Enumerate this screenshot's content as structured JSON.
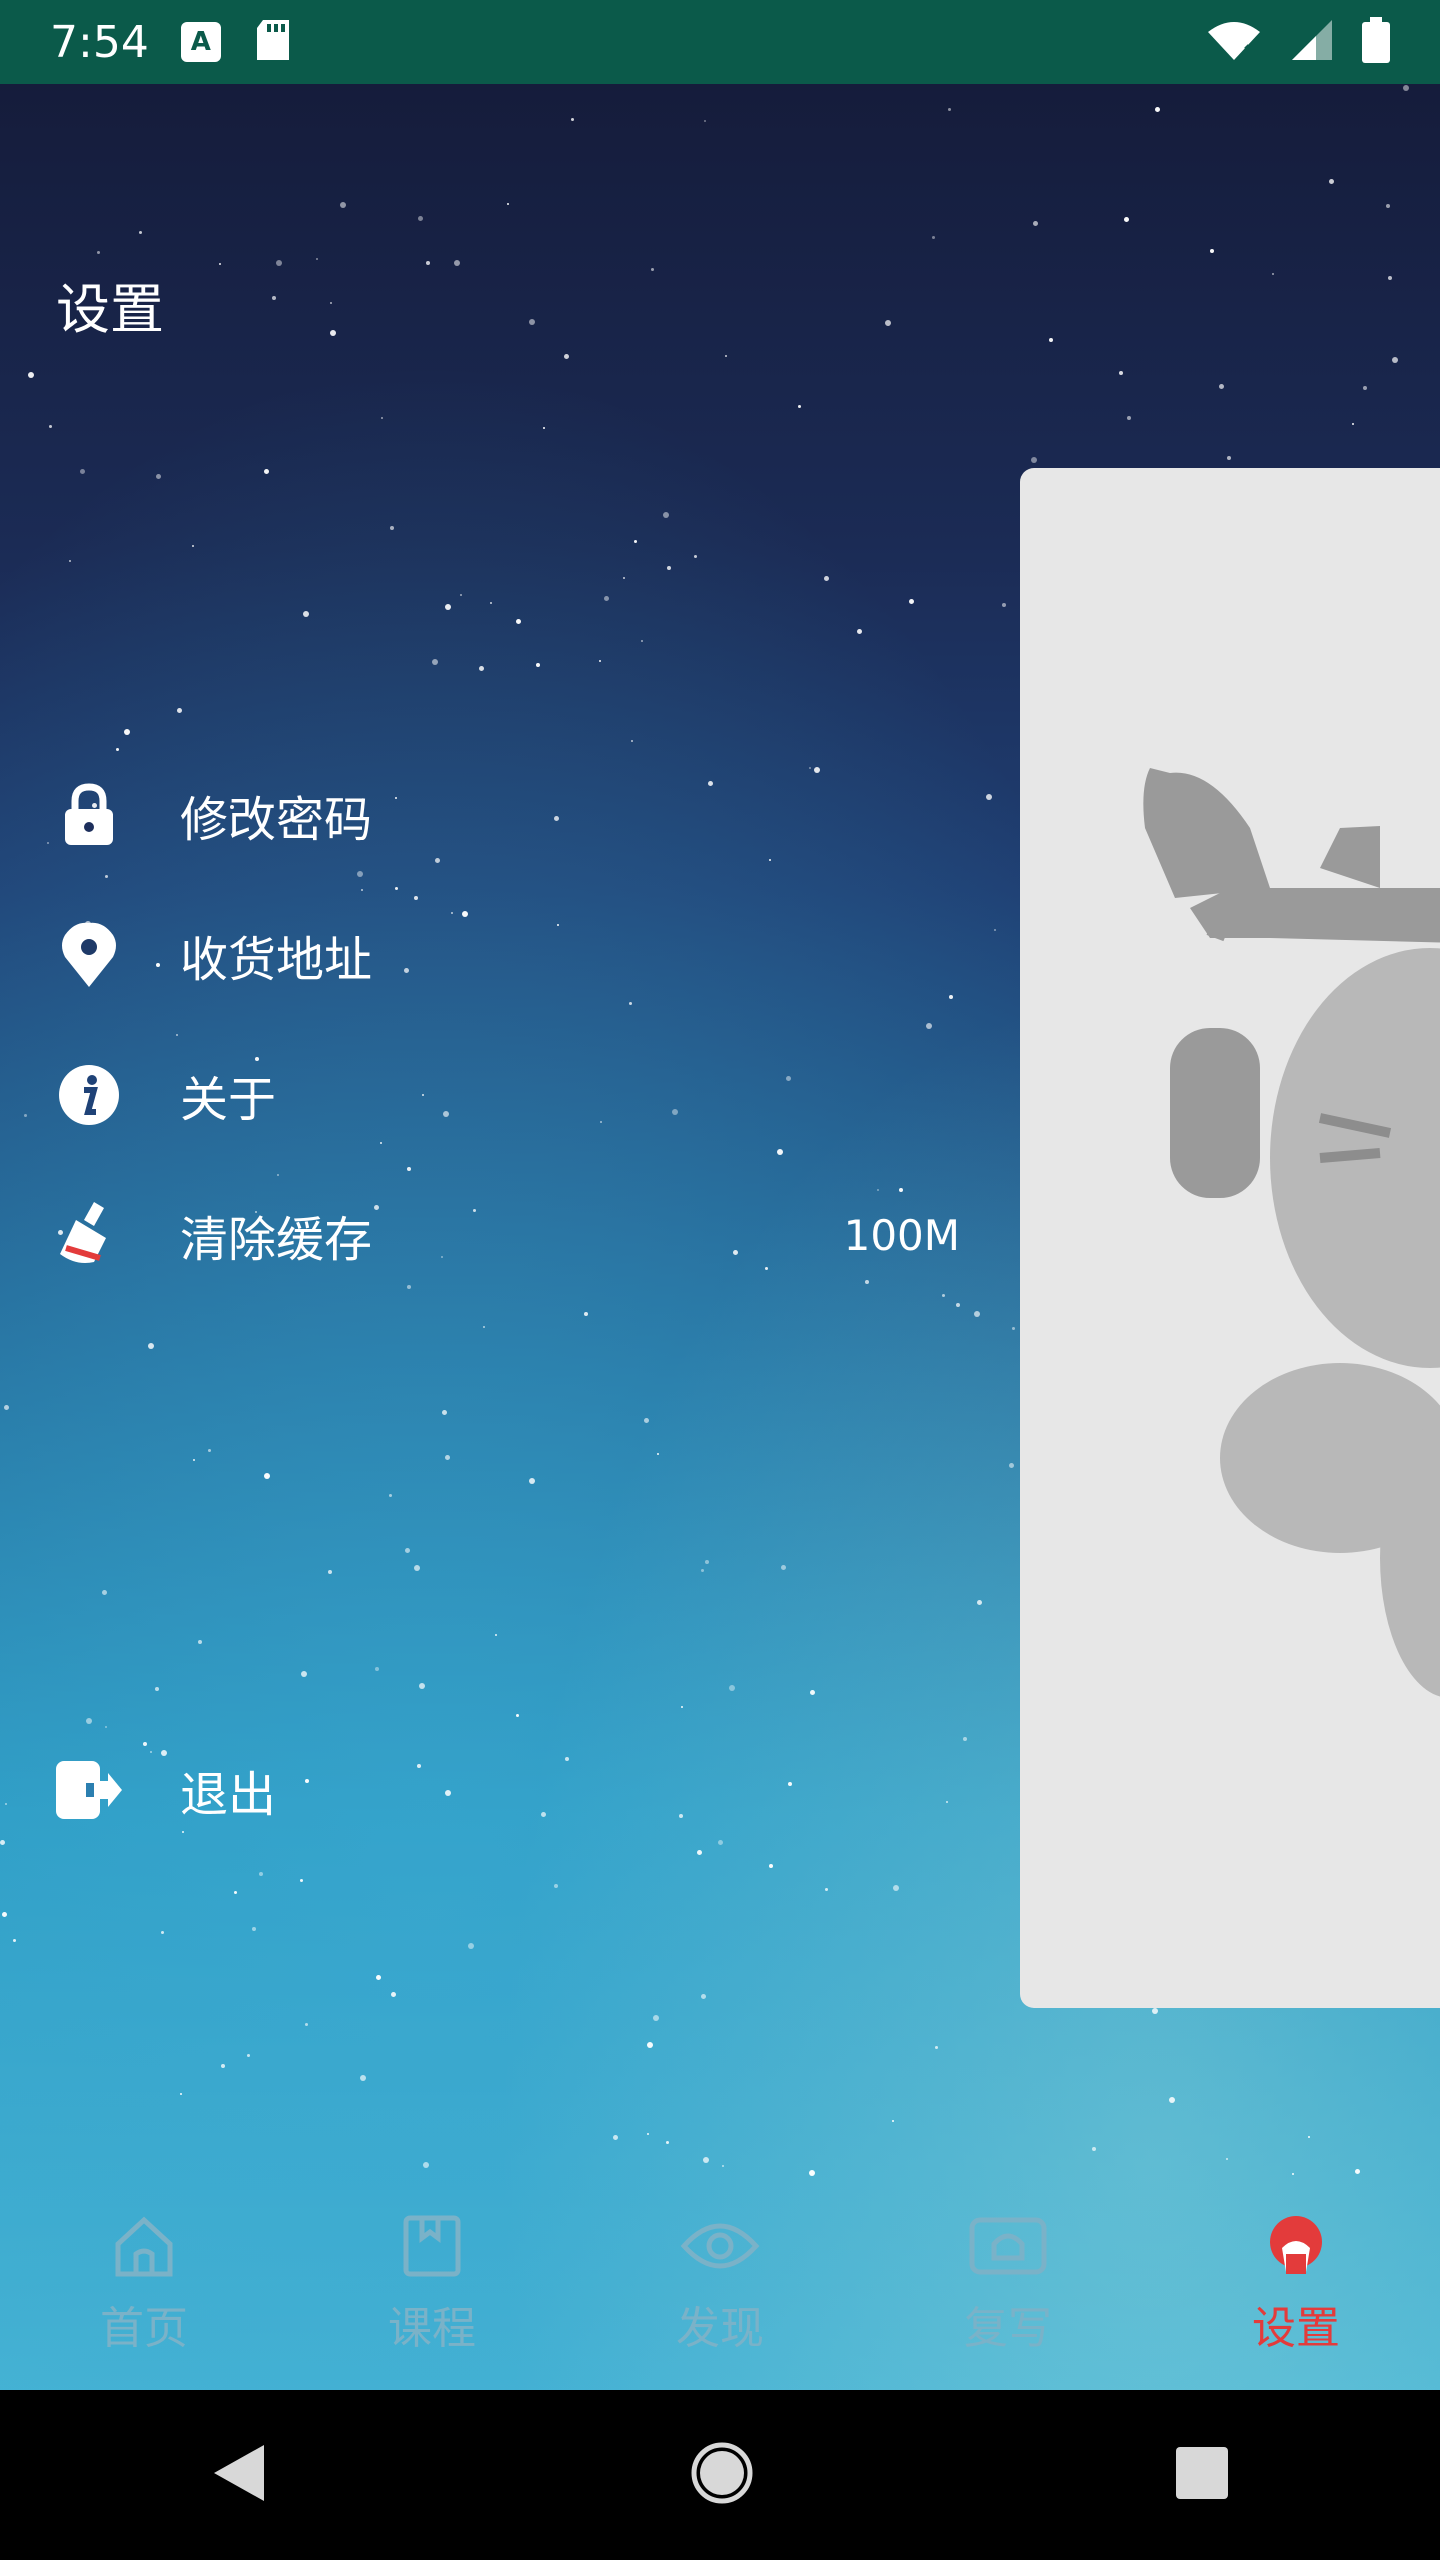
{
  "status_bar": {
    "time": "7:54",
    "notif_icon_1": "A",
    "icons": [
      "text-notification-icon",
      "sd-card-icon",
      "wifi-icon",
      "signal-icon",
      "battery-icon"
    ]
  },
  "drawer": {
    "title": "设置",
    "items": [
      {
        "icon": "lock-icon",
        "label": "修改密码"
      },
      {
        "icon": "location-pin-icon",
        "label": "收货地址"
      },
      {
        "icon": "info-icon",
        "label": "关于"
      },
      {
        "icon": "broom-icon",
        "label": "清除缓存",
        "value": "100M"
      }
    ],
    "logout": {
      "icon": "logout-icon",
      "label": "退出"
    }
  },
  "tabbar": {
    "tabs": [
      {
        "icon": "home-icon",
        "label": "首页"
      },
      {
        "icon": "course-icon",
        "label": "课程"
      },
      {
        "icon": "eye-icon",
        "label": "发现"
      },
      {
        "icon": "review-icon",
        "label": "复写"
      },
      {
        "icon": "settings-avatar-icon",
        "label": "设置",
        "active": true
      }
    ]
  },
  "colors": {
    "accent": "#e33b3b",
    "tab_inactive": "#7ab2c8",
    "status_bar": "#0b5a4a"
  }
}
